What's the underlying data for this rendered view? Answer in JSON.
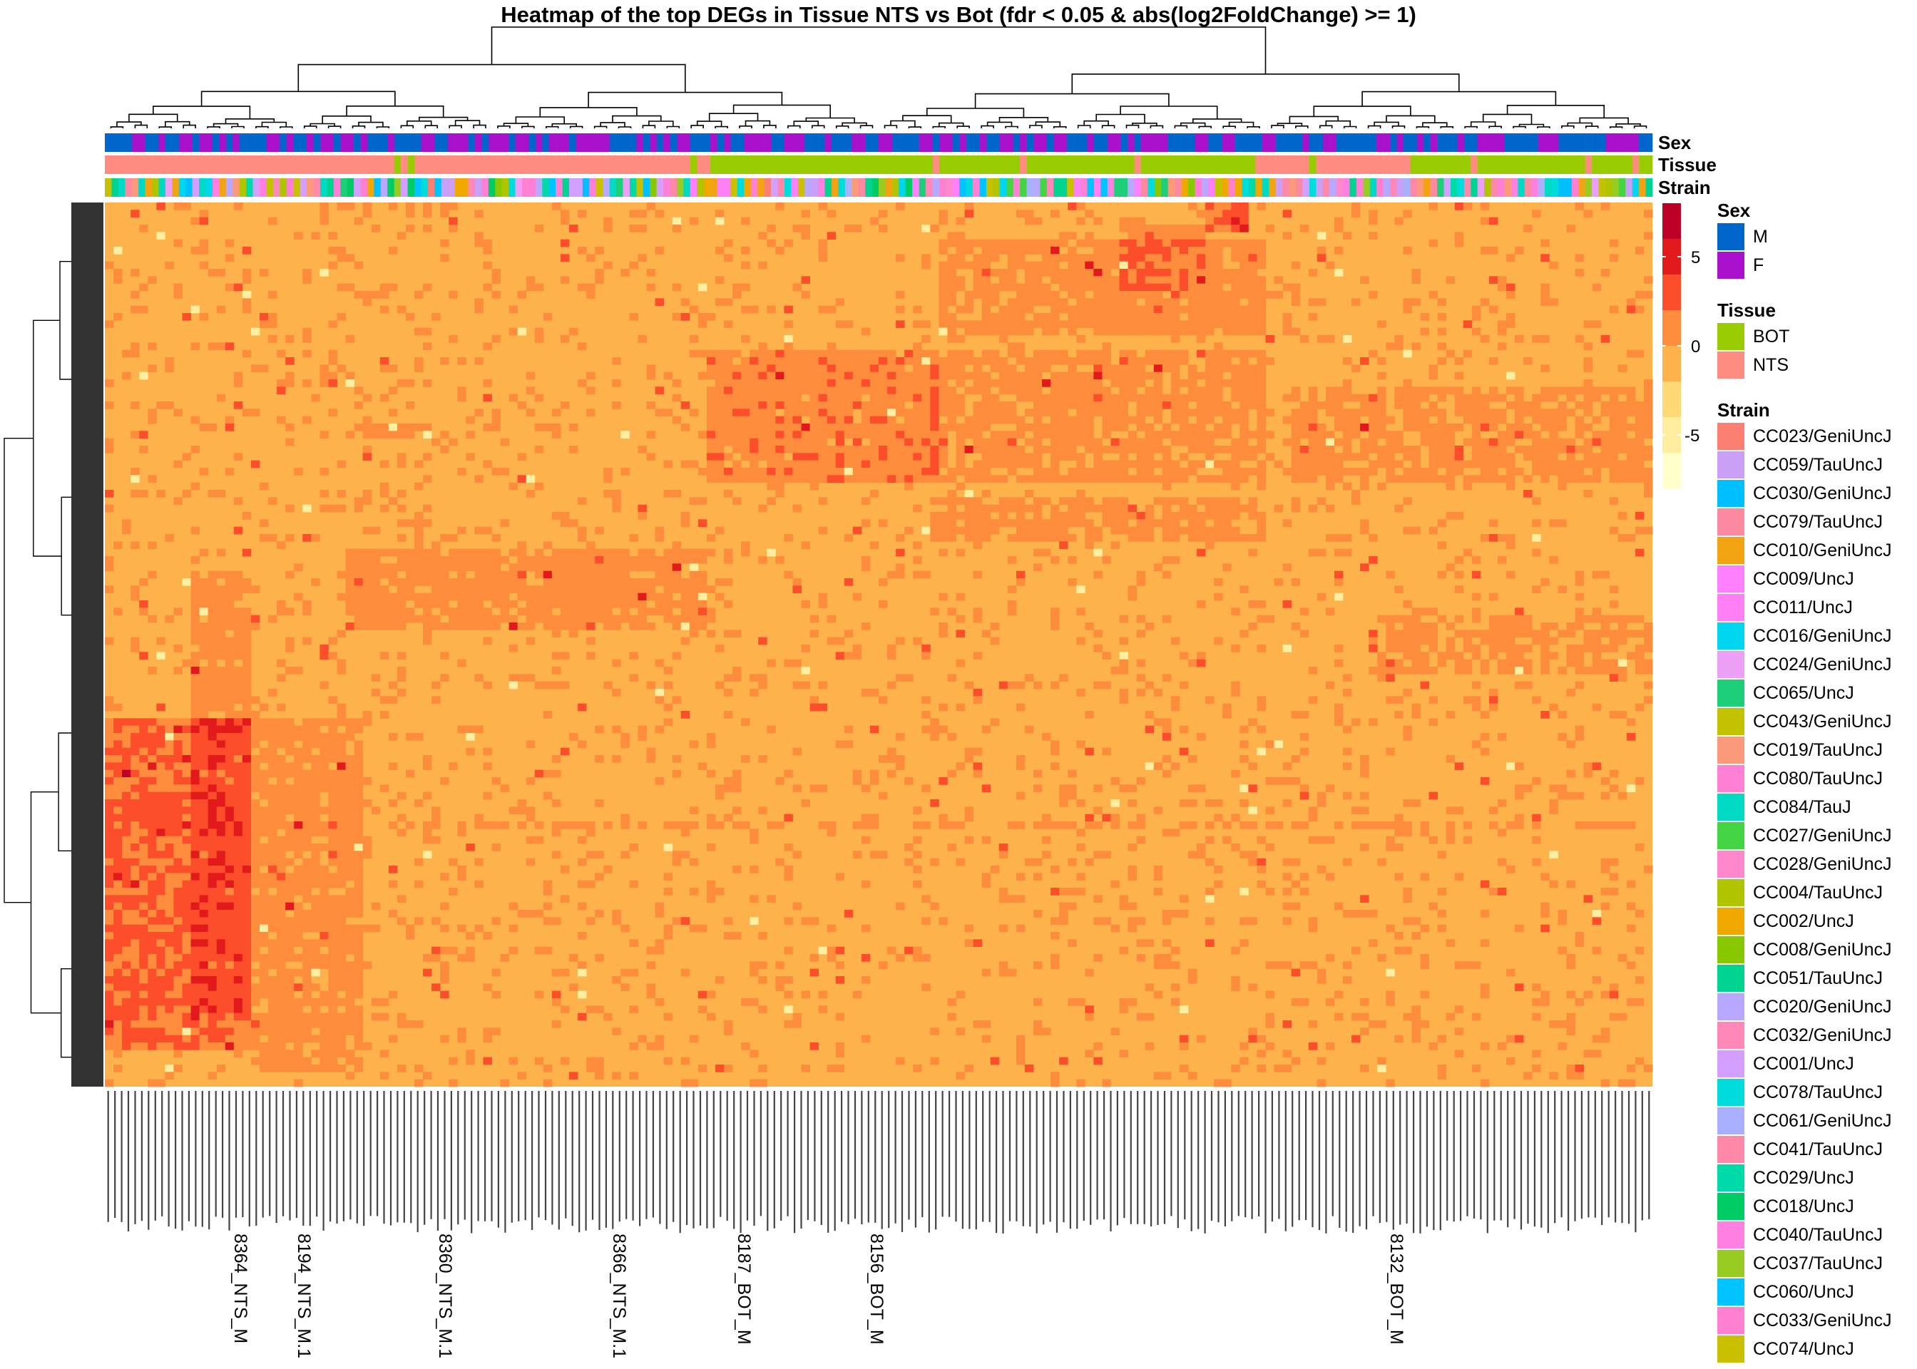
{
  "chart_data": {
    "type": "heatmap",
    "title": "Heatmap of the top DEGs in Tissue NTS vs Bot (fdr < 0.05 & abs(log2FoldChange) >= 1)",
    "color_scale": {
      "range": [
        -8,
        8
      ],
      "ticks": [
        5,
        0,
        -5
      ],
      "colors": [
        "#ffffcc",
        "#ffeda0",
        "#fed976",
        "#feb24c",
        "#fd8d3c",
        "#fc4e2a",
        "#e31a1c",
        "#bd0026"
      ]
    },
    "annotations": [
      {
        "name": "Sex",
        "pattern": "alternating_m_f"
      },
      {
        "name": "Tissue",
        "blocks": [
          {
            "level": "NTS",
            "from": 0,
            "to": 0.389
          },
          {
            "level": "BOT",
            "from": 0.389,
            "to": 0.74
          },
          {
            "level": "NTS",
            "from": 0.74,
            "to": 0.84
          },
          {
            "level": "BOT",
            "from": 0.84,
            "to": 1
          }
        ]
      },
      {
        "name": "Strain",
        "pattern": "mixed"
      }
    ],
    "visible_column_labels": [
      "8194_NTS_M.1",
      "8360_NTS_M.1",
      "8187_BOT_M",
      "8156_BOT_M",
      "8132_BOT_M",
      "8364_NTS_M",
      "8366_NTS_M.1"
    ],
    "legends": {
      "Sex": [
        {
          "label": "M",
          "color": "#0066cc"
        },
        {
          "label": "F",
          "color": "#aa11cc"
        }
      ],
      "Tissue": [
        {
          "label": "BOT",
          "color": "#99cc00"
        },
        {
          "label": "NTS",
          "color": "#ff8c80"
        }
      ],
      "Strain": [
        {
          "label": "CC023/GeniUncJ",
          "color": "#fb8072"
        },
        {
          "label": "CC059/TauUncJ",
          "color": "#c9a0f5"
        },
        {
          "label": "CC030/GeniUncJ",
          "color": "#00bfff"
        },
        {
          "label": "CC079/TauUncJ",
          "color": "#fb8aa0"
        },
        {
          "label": "CC010/GeniUncJ",
          "color": "#f2a312"
        },
        {
          "label": "CC009/UncJ",
          "color": "#ff80ff"
        },
        {
          "label": "CC011/UncJ",
          "color": "#ff80f5"
        },
        {
          "label": "CC016/GeniUncJ",
          "color": "#00d6f0"
        },
        {
          "label": "CC024/GeniUncJ",
          "color": "#eba0f5"
        },
        {
          "label": "CC065/UncJ",
          "color": "#1ecf7a"
        },
        {
          "label": "CC043/GeniUncJ",
          "color": "#c2c200"
        },
        {
          "label": "CC019/TauUncJ",
          "color": "#fb9a7a"
        },
        {
          "label": "CC080/TauUncJ",
          "color": "#ff80d5"
        },
        {
          "label": "CC084/TauJ",
          "color": "#00d9c4"
        },
        {
          "label": "CC027/GeniUncJ",
          "color": "#44d444"
        },
        {
          "label": "CC028/GeniUncJ",
          "color": "#ff88cc"
        },
        {
          "label": "CC004/TauUncJ",
          "color": "#b0c400"
        },
        {
          "label": "CC002/UncJ",
          "color": "#f0a800"
        },
        {
          "label": "CC008/GeniUncJ",
          "color": "#88c800"
        },
        {
          "label": "CC051/TauUncJ",
          "color": "#00d490"
        },
        {
          "label": "CC020/GeniUncJ",
          "color": "#b8a8ff"
        },
        {
          "label": "CC032/GeniUncJ",
          "color": "#ff88b8"
        },
        {
          "label": "CC001/UncJ",
          "color": "#d4a0ff"
        },
        {
          "label": "CC078/TauUncJ",
          "color": "#00dcdc"
        },
        {
          "label": "CC061/GeniUncJ",
          "color": "#a8b0ff"
        },
        {
          "label": "CC041/TauUncJ",
          "color": "#ff88a8"
        },
        {
          "label": "CC029/UncJ",
          "color": "#00d9a8"
        },
        {
          "label": "CC018/UncJ",
          "color": "#00cc66"
        },
        {
          "label": "CC040/TauUncJ",
          "color": "#ff80e0"
        },
        {
          "label": "CC037/TauUncJ",
          "color": "#99cc22"
        },
        {
          "label": "CC060/UncJ",
          "color": "#00c4ff"
        },
        {
          "label": "CC033/GeniUncJ",
          "color": "#ff80d0"
        },
        {
          "label": "CC074/UncJ",
          "color": "#c8c000"
        }
      ]
    }
  }
}
